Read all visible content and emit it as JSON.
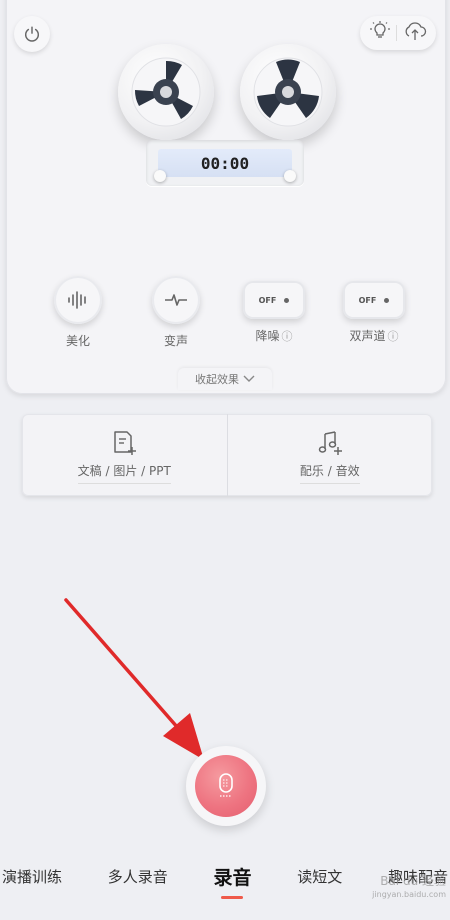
{
  "recorder": {
    "timer": "00:00"
  },
  "effects": [
    {
      "label": "美化",
      "icon": "waveform-icon"
    },
    {
      "label": "变声",
      "icon": "pulse-icon"
    },
    {
      "label": "降噪",
      "toggle": "OFF",
      "info": "ⓘ"
    },
    {
      "label": "双声道",
      "toggle": "OFF",
      "info": "ⓘ"
    }
  ],
  "collapse_label": "收起效果",
  "media": [
    {
      "label": "文稿 / 图片 / PPT",
      "icon": "document-add-icon"
    },
    {
      "label": "配乐 / 音效",
      "icon": "music-add-icon"
    }
  ],
  "nav": {
    "items": [
      "演播训练",
      "多人录音",
      "录音",
      "读短文",
      "趣味配音"
    ],
    "active_index": 2
  },
  "watermark": {
    "text": "Bai du 经验",
    "url": "jingyan.baidu.com"
  },
  "colors": {
    "accent": "#ee7481",
    "active_underline": "#ef5a4a",
    "arrow": "#e02a2a"
  }
}
